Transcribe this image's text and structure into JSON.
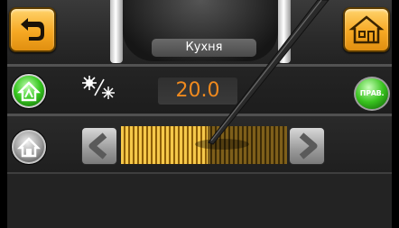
{
  "header": {
    "room_title": "Кухня",
    "back_icon": "back-arrow-icon",
    "home_icon": "home-icon"
  },
  "mode_row": {
    "mode_icon": "auto-home-icon",
    "weather_icon": "sun-snowflake-icon",
    "temperature": "20.0",
    "prav_label": "ПРАВ."
  },
  "slider_row": {
    "mode_icon": "manual-home-icon",
    "level": 0.52
  },
  "colors": {
    "accent_orange": "#f6a823",
    "temperature_text": "#f08a1e",
    "green_button": "#35c61e"
  }
}
